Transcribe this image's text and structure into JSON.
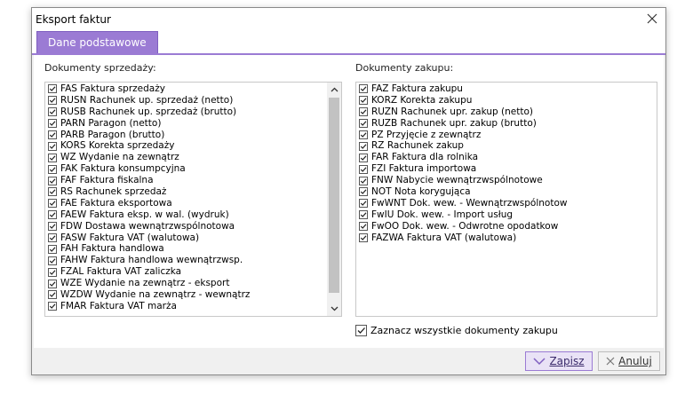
{
  "window": {
    "title": "Eksport faktur"
  },
  "tabs": [
    {
      "label": "Dane podstawowe"
    }
  ],
  "sales": {
    "label": "Dokumenty sprzedaży:",
    "items": [
      "FAS Faktura sprzedaży",
      "RUSN Rachunek up. sprzedaż (netto)",
      "RUSB Rachunek up. sprzedaż (brutto)",
      "PARN Paragon (netto)",
      "PARB Paragon (brutto)",
      "KORS Korekta sprzedaży",
      "WZ Wydanie na zewnątrz",
      "FAK Faktura konsumpcyjna",
      "FAF Faktura fiskalna",
      "RS Rachunek sprzedaż",
      "FAE Faktura eksportowa",
      "FAEW Faktura eksp. w wal. (wydruk)",
      "FDW Dostawa wewnątrzwspólnotowa",
      "FASW Faktura VAT (walutowa)",
      "FAH Faktura handlowa",
      "FAHW Faktura handlowa wewnątrzwsp.",
      "FZAL Faktura VAT zaliczka",
      "WZE Wydanie na zewnątrz - eksport",
      "WZDW Wydanie na zewnątrz - wewnątrz",
      "FMAR Faktura VAT marża"
    ]
  },
  "purchase": {
    "label": "Dokumenty zakupu:",
    "items": [
      "FAZ Faktura zakupu",
      "KORZ Korekta zakupu",
      "RUZN Rachunek upr. zakup (netto)",
      "RUZB Rachunek upr. zakup (brutto)",
      "PZ Przyjęcie z zewnątrz",
      "RZ Rachunek zakup",
      "FAR Faktura dla rolnika",
      "FZI Faktura importowa",
      "FNW Nabycie wewnątrzwspólnotowe",
      "NOT Nota korygująca",
      "FwWNT Dok. wew. - Wewnątrzwspólnotow",
      "FwIU Dok. wew. - Import usług",
      "FwOO Dok. wew. - Odwrotne opodatkow",
      "FAZWA Faktura VAT (walutowa)"
    ],
    "select_all_label": "Zaznacz wszystkie dokumenty zakupu"
  },
  "footer": {
    "save_label": "Zapisz",
    "cancel_label": "Anuluj"
  },
  "colors": {
    "accent": "#9b7bd4",
    "accent_border": "#7f5fc0"
  },
  "icons": [
    "close-icon",
    "checkbox-checked-icon",
    "scroll-up-icon",
    "scroll-down-icon",
    "check-icon",
    "x-icon"
  ]
}
